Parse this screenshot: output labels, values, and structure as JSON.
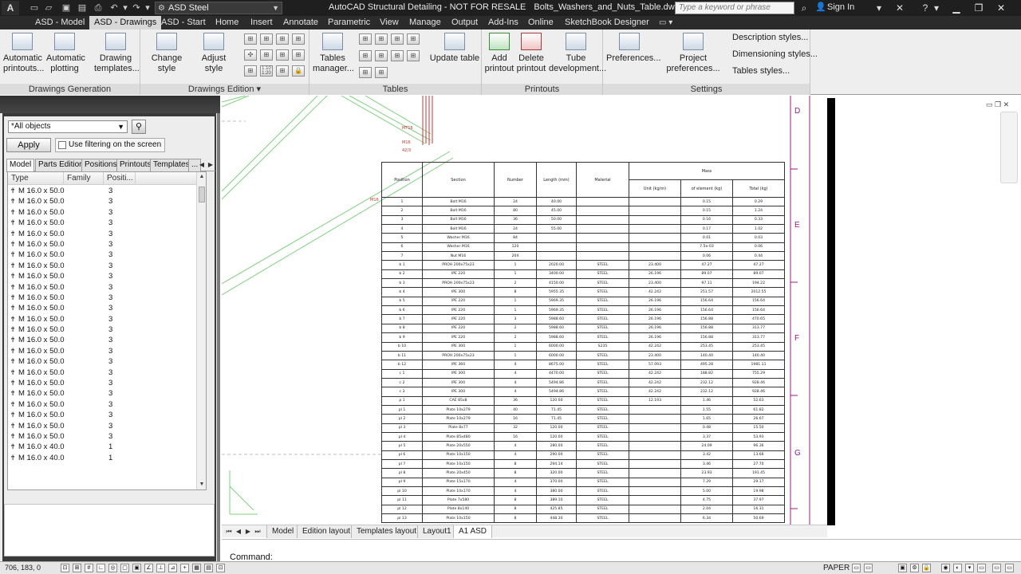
{
  "titlebar": {
    "logo": "A",
    "workspace": "ASD Steel",
    "app_title": "AutoCAD Structural Detailing - NOT FOR RESALE",
    "file_name": "Bolts_Washers_and_Nuts_Table.dwg",
    "search_placeholder": "Type a keyword or phrase",
    "sign_in": "Sign In",
    "icons": [
      "new-icon",
      "open-icon",
      "save-icon",
      "saveas-icon",
      "plot-icon",
      "undo-icon",
      "redo-icon",
      "search-icon",
      "user-icon",
      "exchange-icon",
      "help-icon"
    ]
  },
  "ribbon_tabs": [
    "ASD - Model",
    "ASD - Drawings",
    "ASD - Start",
    "Home",
    "Insert",
    "Annotate",
    "Parametric",
    "View",
    "Manage",
    "Output",
    "Add-Ins",
    "Online",
    "SketchBook Designer"
  ],
  "active_tab": "ASD - Drawings",
  "ribbon": {
    "drawings_generation": {
      "label": "Drawings Generation",
      "buttons": [
        {
          "label": "Automatic printouts...",
          "line1": "Automatic",
          "line2": "printouts..."
        },
        {
          "label": "Automatic plotting",
          "line1": "Automatic",
          "line2": "plotting"
        },
        {
          "label": "Drawing templates...",
          "line1": "Drawing",
          "line2": "templates..."
        }
      ]
    },
    "drawings_edition": {
      "label": "Drawings Edition",
      "change_style": "Change style",
      "adjust_style": "Adjust style",
      "small_labels": [
        "1:10",
        "1:20"
      ]
    },
    "tables": {
      "label": "Tables",
      "manager_line1": "Tables",
      "manager_line2": "manager...",
      "update": "Update table"
    },
    "printouts": {
      "label": "Printouts",
      "add_line1": "Add",
      "add_line2": "printout",
      "delete_line1": "Delete",
      "delete_line2": "printout",
      "tube_line1": "Tube",
      "tube_line2": "development..."
    },
    "settings": {
      "label": "Settings",
      "preferences": "Preferences...",
      "project_preferences": "Project preferences...",
      "description_styles": "Description styles...",
      "dimensioning_styles": "Dimensioning styles...",
      "tables_styles": "Tables styles..."
    }
  },
  "palette": {
    "filter_value": "*All objects",
    "apply_label": "Apply",
    "use_filter_label": "Use filtering on the screen",
    "tabs": [
      "Model",
      "Parts Edition",
      "Positions",
      "Printouts",
      "Templates",
      "..."
    ],
    "active_tab": "Model",
    "columns": [
      "Type",
      "Family",
      "Positi..."
    ],
    "rows": [
      {
        "type": "M 16.0 x 50.0",
        "position": "3"
      },
      {
        "type": "M 16.0 x 50.0",
        "position": "3"
      },
      {
        "type": "M 16.0 x 50.0",
        "position": "3"
      },
      {
        "type": "M 16.0 x 50.0",
        "position": "3"
      },
      {
        "type": "M 16.0 x 50.0",
        "position": "3"
      },
      {
        "type": "M 16.0 x 50.0",
        "position": "3"
      },
      {
        "type": "M 16.0 x 50.0",
        "position": "3"
      },
      {
        "type": "M 16.0 x 50.0",
        "position": "3"
      },
      {
        "type": "M 16.0 x 50.0",
        "position": "3"
      },
      {
        "type": "M 16.0 x 50.0",
        "position": "3"
      },
      {
        "type": "M 16.0 x 50.0",
        "position": "3"
      },
      {
        "type": "M 16.0 x 50.0",
        "position": "3"
      },
      {
        "type": "M 16.0 x 50.0",
        "position": "3"
      },
      {
        "type": "M 16.0 x 50.0",
        "position": "3"
      },
      {
        "type": "M 16.0 x 50.0",
        "position": "3"
      },
      {
        "type": "M 16.0 x 50.0",
        "position": "3"
      },
      {
        "type": "M 16.0 x 50.0",
        "position": "3"
      },
      {
        "type": "M 16.0 x 50.0",
        "position": "3"
      },
      {
        "type": "M 16.0 x 50.0",
        "position": "3"
      },
      {
        "type": "M 16.0 x 50.0",
        "position": "3"
      },
      {
        "type": "M 16.0 x 50.0",
        "position": "3"
      },
      {
        "type": "M 16.0 x 50.0",
        "position": "3"
      },
      {
        "type": "M 16.0 x 50.0",
        "position": "3"
      },
      {
        "type": "M 16.0 x 50.0",
        "position": "3"
      },
      {
        "type": "M 16.0 x 40.0",
        "position": "1"
      },
      {
        "type": "M 16.0 x 40.0",
        "position": "1"
      }
    ]
  },
  "drawing": {
    "frame_letters": [
      "D",
      "E",
      "F",
      "G"
    ],
    "labels": [
      "MT16",
      "M16",
      "42/3",
      "M16"
    ],
    "table": {
      "headers": {
        "position": "Position",
        "section": "Section",
        "number": "Number",
        "length": "Length (mm)",
        "material": "Material",
        "mass": "Mass",
        "unit": "Unit (kg/m)",
        "element": "of element (kg)",
        "total": "Total (kg)"
      },
      "rows": [
        [
          "1",
          "Bolt M16",
          "24",
          "40.00",
          "",
          "",
          "0.15",
          "0.29"
        ],
        [
          "2",
          "Bolt M16",
          "80",
          "45.00",
          "",
          "",
          "0.15",
          "1.24"
        ],
        [
          "3",
          "Bolt M16",
          "36",
          "50.00",
          "",
          "",
          "0.16",
          "0.33"
        ],
        [
          "4",
          "Bolt M16",
          "24",
          "55.00",
          "",
          "",
          "0.17",
          "1.02"
        ],
        [
          "5",
          "Washer M16",
          "84",
          "",
          "",
          "",
          "0.01",
          "0.03"
        ],
        [
          "6",
          "Washer M16",
          "120",
          "",
          "",
          "",
          "7.5e-03",
          "0.06"
        ],
        [
          "7",
          "Nut M16",
          "204",
          "",
          "",
          "",
          "0.06",
          "0.44"
        ],
        [
          "b 1",
          "PROH 200x75x23",
          "1",
          "2020.00",
          "STEEL",
          "23.400",
          "47.27",
          "47.27"
        ],
        [
          "b 2",
          "IPE 220",
          "1",
          "3400.00",
          "STEEL",
          "26.196",
          "89.07",
          "89.07"
        ],
        [
          "b 3",
          "PROH 200x75x23",
          "2",
          "4150.00",
          "STEEL",
          "23.400",
          "97.11",
          "194.22"
        ],
        [
          "b 4",
          "IPE 300",
          "8",
          "5955.35",
          "STEEL",
          "42.242",
          "251.57",
          "2012.55"
        ],
        [
          "b 5",
          "IPE 220",
          "1",
          "5969.35",
          "STEEL",
          "26.196",
          "156.64",
          "156.64"
        ],
        [
          "b 6",
          "IPE 220",
          "1",
          "5969.35",
          "STEEL",
          "26.196",
          "156.64",
          "156.64"
        ],
        [
          "b 7",
          "IPE 220",
          "3",
          "5988.60",
          "STEEL",
          "26.196",
          "156.88",
          "470.65"
        ],
        [
          "b 8",
          "IPE 220",
          "2",
          "5988.60",
          "STEEL",
          "26.196",
          "156.88",
          "313.77"
        ],
        [
          "b 9",
          "IPE 220",
          "2",
          "5988.60",
          "STEEL",
          "26.196",
          "156.88",
          "313.77"
        ],
        [
          "b 10",
          "IPE 300",
          "1",
          "6000.00",
          "S235",
          "42.242",
          "253.45",
          "253.45"
        ],
        [
          "b 11",
          "PROH 200x75x23",
          "1",
          "6000.00",
          "STEEL",
          "23.400",
          "140.40",
          "140.40"
        ],
        [
          "b 12",
          "IPE 360",
          "4",
          "8675.00",
          "STEEL",
          "57.093",
          "495.28",
          "1981.11"
        ],
        [
          "c 1",
          "IPE 300",
          "4",
          "4470.00",
          "STEEL",
          "42.242",
          "188.82",
          "755.29"
        ],
        [
          "c 2",
          "IPE 300",
          "4",
          "5494.86",
          "STEEL",
          "42.242",
          "232.12",
          "928.46"
        ],
        [
          "c 3",
          "IPE 300",
          "4",
          "5494.86",
          "STEEL",
          "42.242",
          "232.12",
          "928.46"
        ],
        [
          "p 1",
          "CAE 85x8",
          "36",
          "120.00",
          "STEEL",
          "12.193",
          "1.46",
          "52.63"
        ],
        [
          "pl 1",
          "Plate 10x279",
          "40",
          "71.45",
          "STEEL",
          "",
          "1.55",
          "61.82"
        ],
        [
          "pl 2",
          "Plate 10x279",
          "16",
          "71.45",
          "STEEL",
          "",
          "1.65",
          "26.67"
        ],
        [
          "pl 3",
          "Plate 8x77",
          "32",
          "120.00",
          "STEEL",
          "",
          "0.48",
          "15.50"
        ],
        [
          "pl 4",
          "Plate 85x480",
          "16",
          "120.00",
          "STEEL",
          "",
          "3.37",
          "53.93"
        ],
        [
          "pl 5",
          "Plate 20x550",
          "4",
          "280.00",
          "STEEL",
          "",
          "24.09",
          "96.36"
        ],
        [
          "pl 6",
          "Plate 10x150",
          "4",
          "290.00",
          "STEEL",
          "",
          "3.42",
          "13.66"
        ],
        [
          "pl 7",
          "Plate 10x150",
          "8",
          "294.14",
          "STEEL",
          "",
          "3.46",
          "27.70"
        ],
        [
          "pl 8",
          "Plate 20x450",
          "8",
          "320.00",
          "STEEL",
          "",
          "23.93",
          "191.45"
        ],
        [
          "pl 9",
          "Plate 15x170",
          "4",
          "370.00",
          "STEEL",
          "",
          "7.29",
          "29.17"
        ],
        [
          "pl 10",
          "Plate 10x170",
          "4",
          "380.00",
          "STEEL",
          "",
          "5.00",
          "19.98"
        ],
        [
          "pl 11",
          "Plate 7x580",
          "8",
          "389.10",
          "STEEL",
          "",
          "4.75",
          "37.97"
        ],
        [
          "pl 12",
          "Plate 8x140",
          "8",
          "425.85",
          "STEEL",
          "",
          "2.04",
          "16.31"
        ],
        [
          "pl 13",
          "Plate 10x150",
          "8",
          "448.30",
          "STEEL",
          "",
          "6.34",
          "50.69"
        ]
      ]
    }
  },
  "layout_tabs": [
    "Model",
    "Edition layout",
    "Templates layout",
    "Layout1",
    "A1 ASD"
  ],
  "active_layout": "A1 ASD",
  "command": {
    "prompt": "Command:"
  },
  "status": {
    "coords": "706, 183, 0",
    "space": "PAPER"
  },
  "colors": {
    "titlebar": "#1f1f20",
    "ribbon_bg": "#eeeeee",
    "active_tab": "#d7d7d7",
    "frame_letters": "#9a1a8a",
    "drawing_lines": "#7fd07f"
  }
}
